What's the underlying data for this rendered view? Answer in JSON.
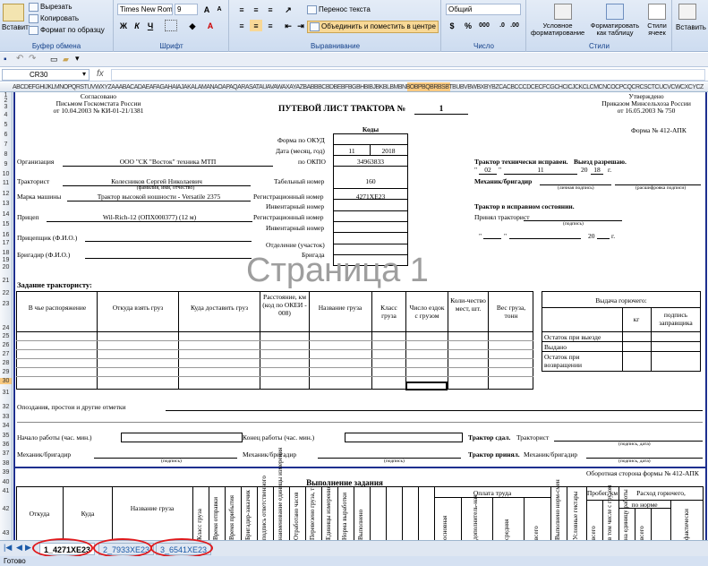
{
  "ribbon": {
    "paste_label": "Вставить",
    "cut_label": "Вырезать",
    "copy_label": "Копировать",
    "format_painter_label": "Формат по образцу",
    "clipboard_group": "Буфер обмена",
    "font_name": "Times New Rom",
    "font_size": "9",
    "font_group": "Шрифт",
    "bold": "Ж",
    "italic": "К",
    "underline": "Ч",
    "wrap_text": "Перенос текста",
    "merge_center": "Объединить и поместить в центре",
    "alignment_group": "Выравнивание",
    "number_format": "Общий",
    "number_group": "Число",
    "percent": "%",
    "thousands": "000",
    "cond_format_label": "Условное форматирование",
    "format_table_label": "Форматировать как таблицу",
    "cell_styles_label": "Стили ячеек",
    "styles_group": "Стили",
    "insert_label": "Вставить"
  },
  "formula_bar": {
    "name_box": "CR30"
  },
  "column_header_text": "ABCDEFGHIJKLMNOPQRSTUVWXYZAAABACADAEAFAGAHAIAJAKALAMANAOAPAQARASATAUAVAWAXAYAZBABBBCBDBEBFBGBHBIBJBKBLBMBNBOBPBQBRBSBTBUBVBWBXBYBZCACBCCCDCECFCGCHCICJCKCLCMCNCOCPCQCRCSCTCUCVCWCXCYCZ",
  "rows": [
    "1",
    "2",
    "3",
    "4",
    "5",
    "6",
    "7",
    "8",
    "9",
    "10",
    "11",
    "12",
    "13",
    "14",
    "15",
    "16",
    "17",
    "18",
    "19",
    "20",
    "21",
    "22",
    "23",
    "24",
    "25",
    "26",
    "27",
    "28",
    "29",
    "30",
    "31",
    "32",
    "33",
    "34",
    "35",
    "36",
    "37",
    "38",
    "39",
    "40",
    "41",
    "42",
    "43"
  ],
  "document": {
    "approved_left_1": "Согласовано",
    "approved_left_2": "Письмом Госкомстата России",
    "approved_left_3": "от 10.04.2003 № КИ-01-21/1381",
    "approved_right_1": "Утверждено",
    "approved_right_2": "Приказом Минсельхоза России",
    "approved_right_3": "от 16.05.2003 № 750",
    "title": "ПУТЕВОЙ ЛИСТ ТРАКТОРА №",
    "number": "1",
    "codes": "Коды",
    "form_no": "Форма № 412-АПК",
    "okud_label": "Форма по ОКУД",
    "date_label": "Дата (месяц, год)",
    "month": "11",
    "year": "2018",
    "okpo_label": "по ОКПО",
    "okpo": "34963833",
    "org_label": "Организация",
    "org": "ООО \"СК \"Восток\" техника МТП",
    "tractor_ok": "Трактор технически исправен.",
    "exit_allowed": "Выезд разрешаю.",
    "d_day": "02",
    "d_month": "11",
    "d_year1": "20",
    "d_year2": "18",
    "g": "г.",
    "driver_label": "Тракторист",
    "driver": "Колесников Сергей Николаевич",
    "fio_hint": "(фамилия, имя, отчество)",
    "tab_label": "Табельный номер",
    "tab_no": "160",
    "mechanic_label": "Механик/бригадир",
    "sign_hint": "(личная подпись)",
    "decode_hint": "(расшифровка подписи)",
    "brand_label": "Марка машины",
    "brand": "Трактор высокой ношности - Versatile 2375",
    "reg_label": "Регистрационный номер",
    "reg_no": "4271ХЕ23",
    "inv_label": "Инвентарный номер",
    "tractor_ok2": "Трактор в исправном состоянии.",
    "accepted": "Принял тракторист",
    "sign2": "(подпись)",
    "trailer_label": "Прицеп",
    "trailer": "Wil-Rich-12 (ОПХ000377) (12 м)",
    "reg_label2": "Регистрационный номер",
    "inv_label2": "Инвентарный номер",
    "d2_year": "20",
    "trailer_op_label": "Прицепщик (Ф.И.О.)",
    "dept_label": "Отделение (участок)",
    "brig_label": "Бригадир (Ф.И.О.)",
    "brigade_label": "Бригада",
    "watermark": "Страница 1",
    "task_label": "Задание трактористу:",
    "col_whom": "В чье распоряжение",
    "col_from": "Откуда взять груз",
    "col_to": "Куда доставить груз",
    "col_dist": "Расстояние, км (код по ОКЕИ - 008)",
    "col_name": "Название груза",
    "col_class": "Класс груза",
    "col_trips": "Число ездок с грузом",
    "col_qty": "Коли-чество мест, шт.",
    "col_weight": "Вес груза, тонн",
    "fuel_title": "Выдача горючего:",
    "fuel_kg": "кг",
    "fuel_sign": "подпись заправщика",
    "fuel_rest_out": "Остаток при выезде",
    "fuel_issued": "Выдано",
    "fuel_rest_in": "Остаток при возвращении",
    "delays_label": "Опоздания, простои и другие отметки",
    "start_label": "Начало работы (час. мин.)",
    "end_label": "Конец работы (час. мин.)",
    "handed": "Трактор сдал.",
    "handed_who": "Тракторист",
    "sign_date": "(подпись, дата)",
    "mech2": "Механик/бригадир",
    "sign3": "(подпись)",
    "mech3": "Механик/бригадир",
    "sign4": "(подпись)",
    "accepted2": "Трактор принял.",
    "accepted2_who": "Механик/бригадир",
    "sign_date2": "(подпись, дата)",
    "reverse": "Оборотная сторона формы № 412-АПК",
    "exec_title": "Выполнение задания",
    "x_from": "Откуда",
    "x_to": "Куда",
    "x_name": "Название груза",
    "x_class": "Класс груза",
    "x_time1": "Время отправки",
    "x_time2": "Время прибытия",
    "x_brig": "Бригадир-заказчик",
    "x_sign": "подпись ответственного",
    "x_unit": "наименование единицы измерения",
    "x_hours": "Отработано часов",
    "x_trans": "Перевезено груза, т",
    "x_units": "Единицы измерения",
    "x_norm": "Норма выработки",
    "x_done": "Выполнено",
    "x_pay": "Оплата труда",
    "x_basic": "основная",
    "x_extra": "дополнитель-ная",
    "x_mid": "средняя",
    "x_total": "всего",
    "x_done2": "Выполнено норм-смен",
    "x_cond": "Условные гектары",
    "x_run": "Пробег, км",
    "x_run_total": "всего",
    "x_run_load": "в том числе с грузом",
    "x_fuel": "Расход горючего,",
    "x_norm2": "по норме",
    "x_norm_per": "на единицу работы",
    "x_norm_all": "всего",
    "x_fact": "фактически"
  },
  "tabs": [
    {
      "label": "1_4271ХЕ23",
      "active": true
    },
    {
      "label": "2_7933ХЕ23",
      "active": false
    },
    {
      "label": "3_6541ХЕ23",
      "active": false
    }
  ],
  "status": "Готово",
  "colors": {
    "accent": "#15428b",
    "highlight": "#e0191c",
    "selected": "#f8c980"
  }
}
